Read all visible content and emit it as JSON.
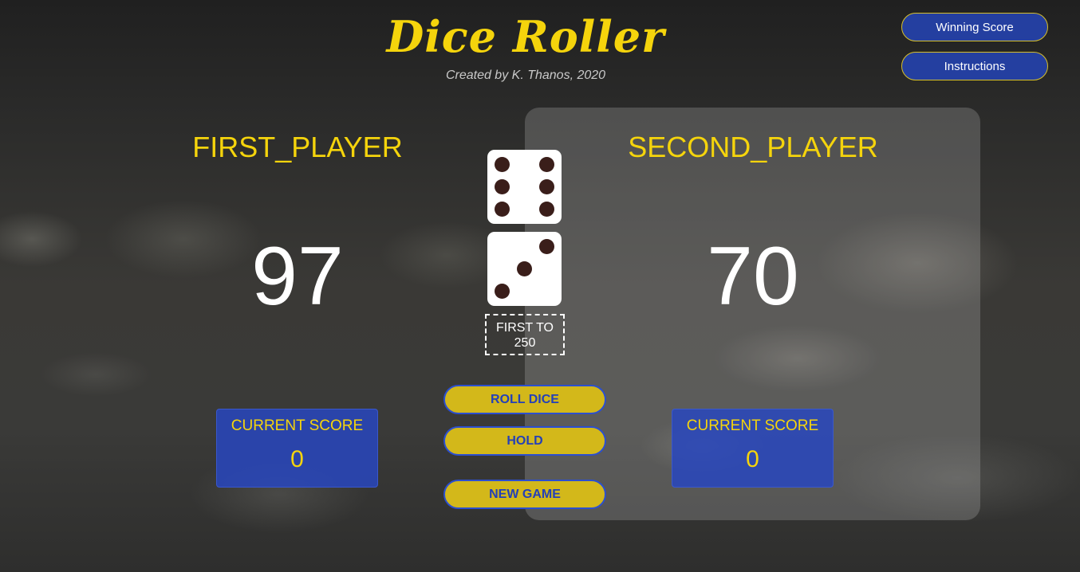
{
  "header": {
    "title": "Dice Roller",
    "subtitle": "Created by K. Thanos, 2020"
  },
  "menu": {
    "winning_score_label": "Winning Score",
    "instructions_label": "Instructions"
  },
  "players": [
    {
      "name": "FIRST_PLAYER",
      "score": "97",
      "current_label": "CURRENT SCORE",
      "current_value": "0",
      "active": false
    },
    {
      "name": "SECOND_PLAYER",
      "score": "70",
      "current_label": "CURRENT SCORE",
      "current_value": "0",
      "active": true
    }
  ],
  "dice": [
    6,
    3
  ],
  "target": {
    "line1": "FIRST TO",
    "line2": "250"
  },
  "controls": {
    "roll_label": "ROLL DICE",
    "hold_label": "HOLD",
    "new_game_label": "NEW GAME"
  },
  "colors": {
    "accent_yellow": "#f5d40c",
    "button_blue": "#243fa0",
    "pip": "#3a1e1a"
  }
}
